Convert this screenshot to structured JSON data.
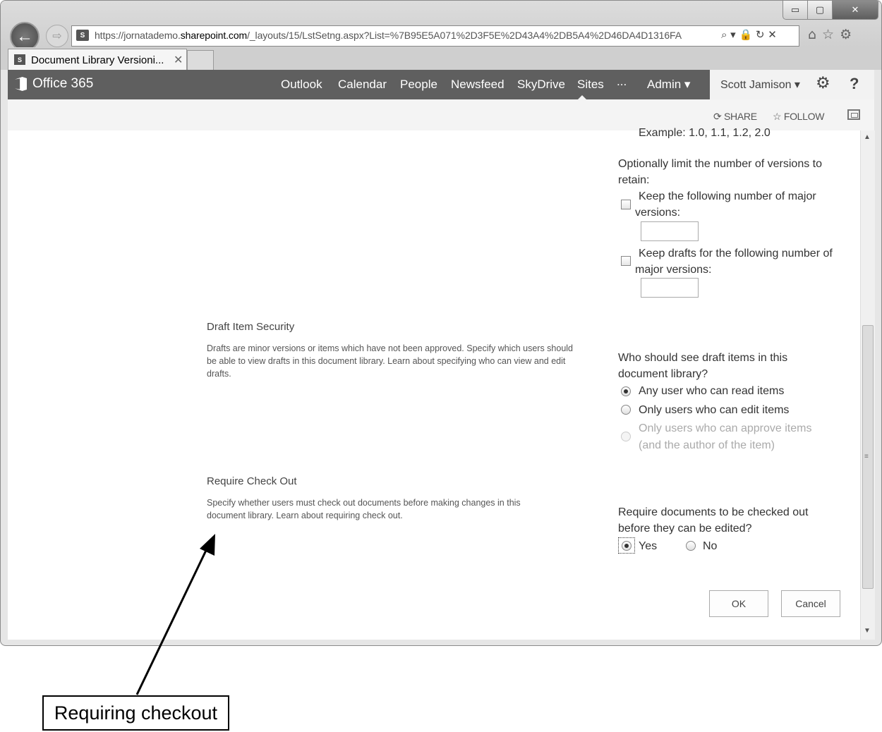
{
  "browser": {
    "url_prefix": "https://jornatademo.",
    "url_domain": "sharepoint.com",
    "url_rest": "/_layouts/15/LstSetng.aspx?List=%7B95E5A071%2D3F5E%2D43A4%2DB5A4%2D46DA4D1316FA",
    "tab_title": "Document Library Versioni...",
    "tab_close": "✕",
    "window_min": "▭",
    "window_max": "▢",
    "window_close": "✕",
    "back": "←",
    "forward": "⇨",
    "addr_icons": "⌕ ▾ 🔒 ↻ ✕",
    "nav_icons": "⌂☆⚙"
  },
  "suitebar": {
    "brand": "Office 365",
    "nav": [
      "Outlook",
      "Calendar",
      "People",
      "Newsfeed",
      "SkyDrive",
      "Sites",
      "...",
      "Admin ▾"
    ],
    "user": "Scott Jamison ▾",
    "gear": "⚙",
    "help": "?"
  },
  "ribbon": {
    "share": "⟳ SHARE",
    "follow": "☆ FOLLOW"
  },
  "versions": {
    "example_text": "Example: 1.0, 1.1, 1.2, 2.0",
    "limit_label": "Optionally limit the number of versions to retain:",
    "keep_major_label": "Keep the following number of major versions:",
    "keep_major_value": "",
    "keep_drafts_label": "Keep drafts for the following number of major versions:",
    "keep_drafts_value": ""
  },
  "draft_security": {
    "title": "Draft Item Security",
    "description": "Drafts are minor versions or items which have not been approved. Specify which users should be able to view drafts in this document library.    Learn about specifying who can view and edit drafts.",
    "question": "Who should see draft items in this document library?",
    "options": [
      {
        "label": "Any user who can read items",
        "selected": true,
        "enabled": true
      },
      {
        "label": "Only users who can edit items",
        "selected": false,
        "enabled": true
      },
      {
        "label": "Only users who can approve items (and the author of the item)",
        "selected": false,
        "enabled": false
      }
    ]
  },
  "checkout": {
    "title": "Require Check Out",
    "description": "Specify whether users must check out documents before making changes in this document library.    Learn about requiring check out.",
    "question": "Require documents to be checked out before they can be edited?",
    "yes_label": "Yes",
    "no_label": "No",
    "selected": "Yes"
  },
  "buttons": {
    "ok": "OK",
    "cancel": "Cancel"
  },
  "annotation": {
    "callout": "Requiring checkout"
  },
  "scrollbar": {
    "up": "▲",
    "down": "▼",
    "grip": "≡"
  }
}
